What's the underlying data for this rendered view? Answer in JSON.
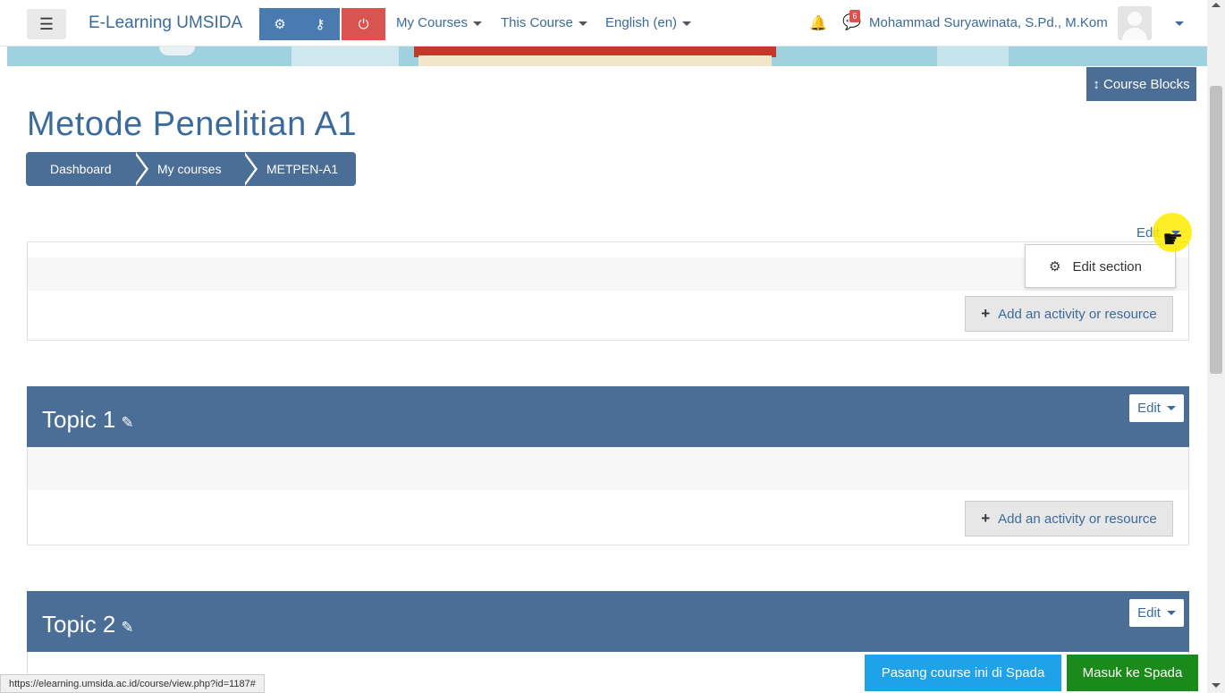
{
  "navbar": {
    "menu_icon": "☰",
    "brand": "E-Learning UMSIDA",
    "settings_icon": "⚙",
    "key_icon": "⚷",
    "power_icon": "⏻",
    "my_courses": "My Courses",
    "this_course": "This Course",
    "language": "English (en)",
    "bell_icon": "🔔",
    "message_icon": "💬",
    "message_count": "6",
    "user_name": "Mohammad Suryawinata, S.Pd., M.Kom"
  },
  "course_blocks": "↕ Course Blocks",
  "page_title": "Metode Penelitian A1",
  "breadcrumb": [
    "Dashboard",
    "My courses",
    "METPEN-A1"
  ],
  "section0": {
    "edit_label": "Edit",
    "menu_item": "Edit section",
    "menu_icon": "⚙",
    "add_label": "Add an activity or resource"
  },
  "topics": [
    {
      "name": "Topic 1",
      "edit_label": "Edit",
      "add_label": "Add an activity or resource"
    },
    {
      "name": "Topic 2",
      "edit_label": "Edit"
    }
  ],
  "pencil_icon": "✎",
  "status_url": "https://elearning.umsida.ac.id/course/view.php?id=1187#",
  "bottom_buttons": {
    "pasang": "Pasang course ini di Spada",
    "masuk": "Masuk ke Spada"
  },
  "colors": {
    "primary": "#4a6e95",
    "link": "#3b6b9a",
    "danger": "#d9534f",
    "spada_blue": "#1fa2e8",
    "spada_green": "#1a8a1a"
  }
}
